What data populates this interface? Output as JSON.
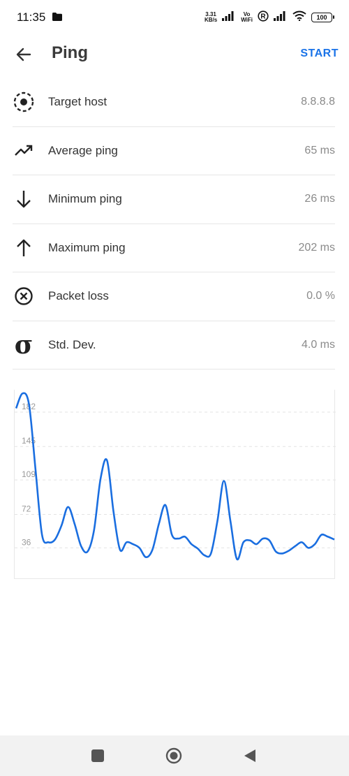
{
  "status_bar": {
    "time": "11:35",
    "net_speed_value": "3.31",
    "net_speed_unit": "KB/s",
    "volte_top": "Vo",
    "volte_bottom": "WiFi",
    "roaming": "R",
    "battery": "100"
  },
  "app_bar": {
    "title": "Ping",
    "start_label": "START"
  },
  "stats": [
    {
      "icon": "target-icon",
      "label": "Target host",
      "value": "8.8.8.8"
    },
    {
      "icon": "trending-up-icon",
      "label": "Average ping",
      "value": "65 ms"
    },
    {
      "icon": "arrow-down-icon",
      "label": "Minimum ping",
      "value": "26 ms"
    },
    {
      "icon": "arrow-up-icon",
      "label": "Maximum ping",
      "value": "202 ms"
    },
    {
      "icon": "cancel-icon",
      "label": "Packet loss",
      "value": "0.0 %"
    },
    {
      "icon": "sigma-icon",
      "label": "Std. Dev.",
      "value": "4.0 ms",
      "glyph": "σ"
    }
  ],
  "chart_data": {
    "type": "line",
    "title": "",
    "xlabel": "",
    "ylabel": "",
    "y_ticks": [
      36,
      72,
      109,
      145,
      182
    ],
    "ylim": [
      10,
      200
    ],
    "grid": true,
    "series": [
      {
        "color": "#1a6ee0",
        "values": [
          186,
          202,
          190,
          120,
          50,
          42,
          45,
          60,
          80,
          62,
          38,
          32,
          55,
          110,
          130,
          75,
          34,
          42,
          40,
          36,
          26,
          34,
          62,
          82,
          50,
          46,
          48,
          40,
          35,
          28,
          30,
          65,
          108,
          65,
          24,
          42,
          44,
          40,
          46,
          44,
          32,
          30,
          33,
          38,
          42,
          36,
          40,
          50,
          48,
          45
        ]
      }
    ]
  },
  "nav_bar": {
    "recents": "square-icon",
    "home": "circle-icon",
    "back": "triangle-back-icon"
  },
  "colors": {
    "accent": "#1a73e8",
    "line": "#1a6ee0",
    "divider": "#e6e6e6",
    "muted_text": "#8a8a8a"
  }
}
